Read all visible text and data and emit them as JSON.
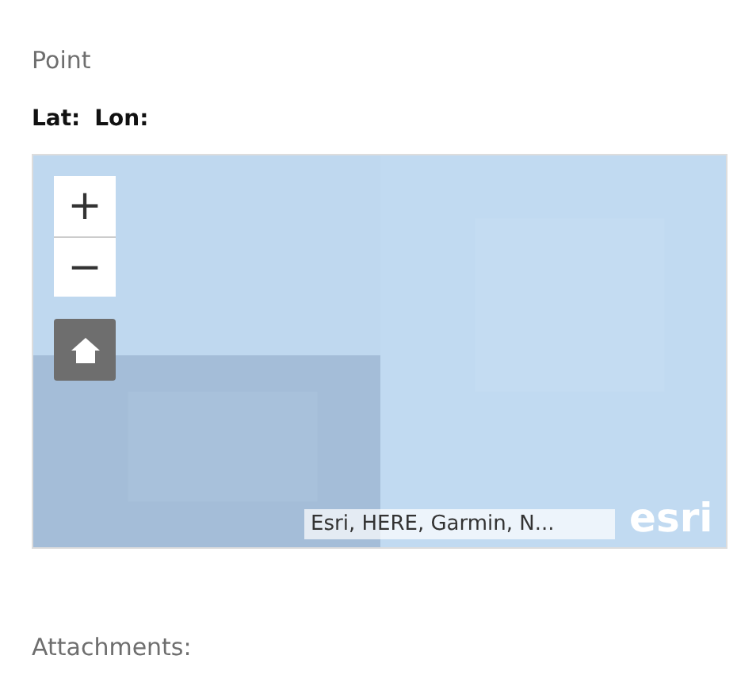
{
  "heading": "Point",
  "coords": "**Lat:**  **Lon:**",
  "map": {
    "kind": "picture",
    "zoom_in": "+",
    "zoom_out": "−",
    "attribution": "Esri, HERE, Garmin, N...",
    "logo": "esri"
  },
  "attachments_label": "Attachments:"
}
